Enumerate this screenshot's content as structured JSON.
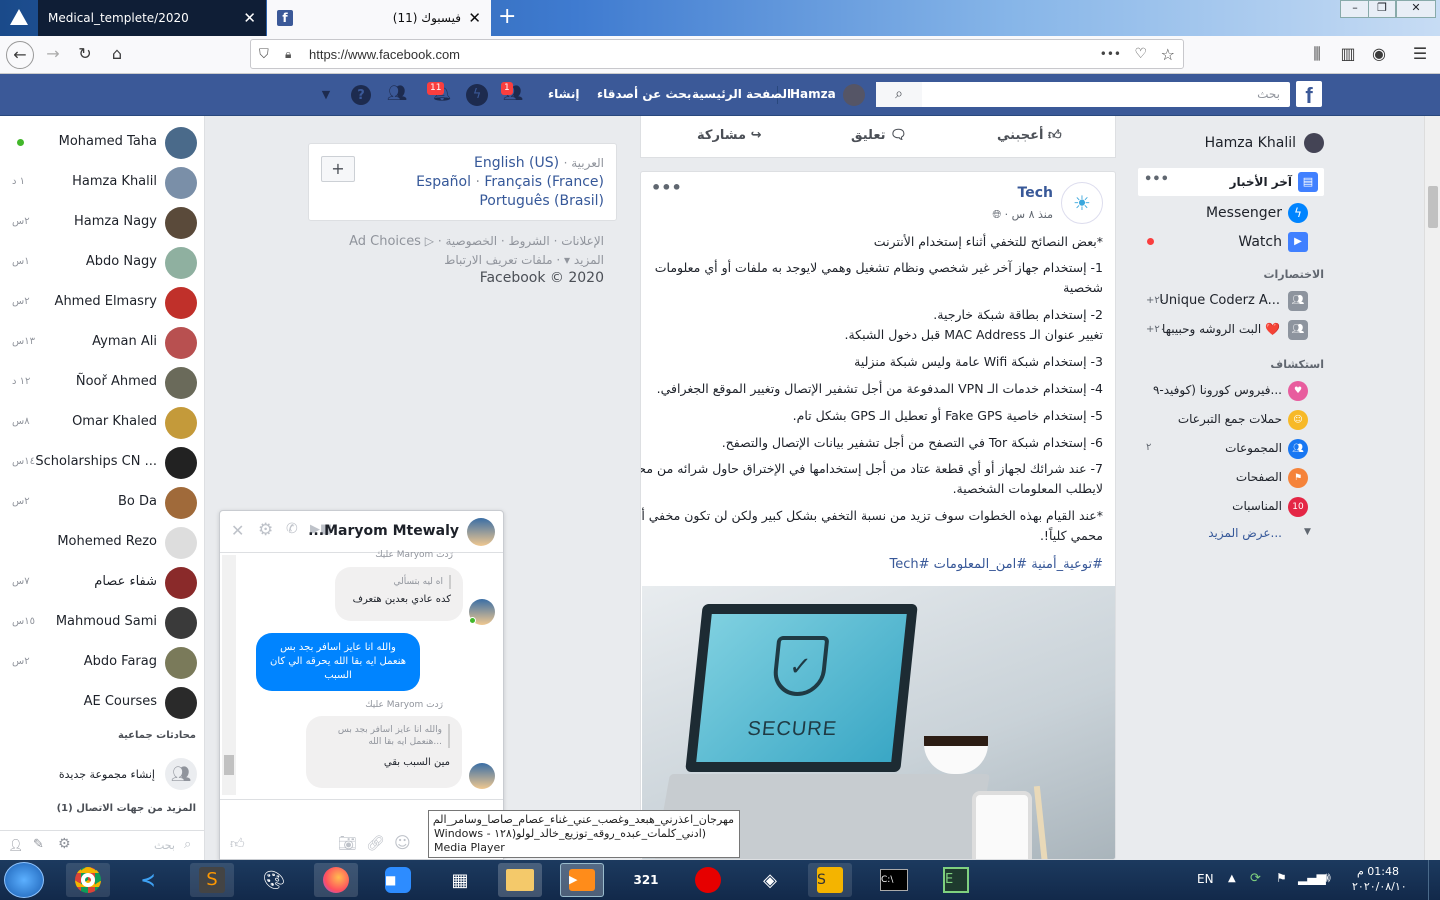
{
  "browser": {
    "tabs": [
      {
        "label": "Medical_templete/2020",
        "active": false
      },
      {
        "label": "(11) فيسبوك",
        "active": true
      }
    ],
    "new_tab": "+",
    "url": "https://www.facebook.com",
    "more": "•••"
  },
  "fb_header": {
    "search_placeholder": "بحث",
    "profile_name": "Hamza",
    "home": "الصفحة الرئيسية",
    "find_friends": "بحث عن أصدقاء",
    "create": "إنشاء",
    "friend_badge": "1",
    "notif_badge": "11"
  },
  "contacts": [
    {
      "name": "Mohamed Taha",
      "time": "",
      "online": true,
      "color": "#4a6a8a"
    },
    {
      "name": "Hamza Khalil",
      "time": "١ د",
      "online": false,
      "color": "#7a8fa8"
    },
    {
      "name": "Hamza Nagy",
      "time": "٢س",
      "online": false,
      "color": "#5a4a3a"
    },
    {
      "name": "Abdo Nagy",
      "time": "١س",
      "online": false,
      "color": "#8fb0a0"
    },
    {
      "name": "Ahmed Elmasry",
      "time": "٢س",
      "online": false,
      "color": "#c0302a"
    },
    {
      "name": "Ayman Ali",
      "time": "١٣س",
      "online": false,
      "color": "#b85050"
    },
    {
      "name": "Ñooř Ahmed",
      "time": "١٢ د",
      "online": false,
      "color": "#6a6a5a"
    },
    {
      "name": "Omar Khaled",
      "time": "٨س",
      "online": false,
      "color": "#c49a3a"
    },
    {
      "name": "Scholarships CN ...",
      "time": "١٤س",
      "online": false,
      "color": "#222222"
    },
    {
      "name": "Bo Da",
      "time": "٢س",
      "online": false,
      "color": "#a06a3a"
    },
    {
      "name": "Mohemed Rezo",
      "time": "",
      "online": false,
      "color": "#dddddd"
    },
    {
      "name": "شفاء عصام",
      "time": "٧س",
      "online": false,
      "color": "#8a2a2a"
    },
    {
      "name": "Mahmoud Sami",
      "time": "١٥س",
      "online": false,
      "color": "#3a3a3a"
    },
    {
      "name": "Abdo Farag",
      "time": "٢س",
      "online": false,
      "color": "#7a7a5a"
    },
    {
      "name": "AE Courses",
      "time": "",
      "online": false,
      "color": "#2a2a2a"
    }
  ],
  "chat_sidebar": {
    "group_header": "محادثات جماعية",
    "new_group": "إنشاء مجموعة جديدة",
    "more_contacts": "المزيد من جهات الاتصال (1)",
    "search_placeholder": "بحث"
  },
  "chat_window": {
    "title": "Maryom Mtewaly...",
    "reply_top": "رَدت Maryom عليك",
    "quoted_top": "اه ليه بتسألي",
    "msg_in_1": "كده عادي بعدين هتعرف",
    "msg_out": "والله انا عايز اسافر بجد بس هنعمل ايه بقا الله يحرقه الي كان السبب",
    "reply_bottom": "رَدت Maryom عليك",
    "quoted_bottom": "والله انا عايز اسافر بجد بس هنعمل ايه بقا الله...",
    "msg_in_2": "مين السبب بقي"
  },
  "language_box": {
    "current": "العربية",
    "languages": [
      "English (US)",
      "Español",
      "Français (France)",
      "Português (Brasil)"
    ],
    "add": "+"
  },
  "footer_links": {
    "line1": [
      "الخصوصية",
      "الشروط",
      "الإعلانات",
      "Ad Choices"
    ],
    "line2": [
      "ملفات تعريف الارتباط",
      "المزيد"
    ],
    "copyright": "Facebook © 2020"
  },
  "post_actions": {
    "like": "أعجبني",
    "comment": "تعليق",
    "share": "مشاركة"
  },
  "post": {
    "page_name": "Tech",
    "time": "منذ ٨ س",
    "lines": [
      "*بعض النصائح للتخفي أثناء إستخدام الأنترنت",
      "1- إستخدام جهاز آخر غير شخصي ونظام تشغيل وهمي لايوجد به ملفات أو أي معلومات",
      "شخصية",
      "2- إستخدام بطاقة شبكة خارجية.",
      "تغيير عنوان الـ MAC Address قبل دخول الشبكة.",
      "3- إستخدام شبكة Wifi عامة وليس شبكة منزلية",
      "4- إستخدام خدمات الـ VPN المدفوعة من أجل تشفير الإتصال وتغيير الموقع الجغرافي.",
      "5- إستخدام خاصية Fake GPS أو تعطيل الـ GPS بشكل تام.",
      "6- إستخدام شبكة Tor في التصفح من أجل تشفير بيانات الإتصال والتصفح.",
      "7- عند شرائك لجهاز أو أي قطعة عتاد من أجل إستخدامها في الإختراق حاول شرائه من محل",
      "لايطلب المعلومات الشخصية.",
      "*عند القيام بهذه الخطوات سوف تزيد من نسبة التخفي بشكل كبير ولكن لن تكون مخفي أو",
      "محمي كلياً!."
    ],
    "hashtags": "#توعية_أمنية #امن_المعلومات #Tech",
    "image_text": "SECURE"
  },
  "right_nav": {
    "user": "Hamza Khalil",
    "news_feed": "آخر الأخبار",
    "messenger": "Messenger",
    "watch": "Watch",
    "shortcuts_header": "الاختصارات",
    "shortcut_1": "Unique Coderz A...",
    "shortcut_1_count": "+٢٠",
    "shortcut_2": "البت الروشه وحبيبها ❤️",
    "shortcut_2_count": "+٢٠",
    "explore_header": "استكشاف",
    "explore": [
      {
        "label": "فيروس كورونا (كوفيد-٩...",
        "count": ""
      },
      {
        "label": "حملات جمع التبرعات",
        "count": ""
      },
      {
        "label": "المجموعات",
        "count": "٢"
      },
      {
        "label": "الصفحات",
        "count": ""
      },
      {
        "label": "المناسبات",
        "count": ""
      }
    ],
    "see_more": "عرض المزيد..."
  },
  "taskbar": {
    "tooltip": "مهرجان_اعذرني_هبعد_وغصب_عني_غناء_عصام_صاصا_وسامر_الم (ادني_كلمات_عبده_روقه_توزيع_خالد_لولو(١٢٨ - Windows Media Player",
    "lang": "EN",
    "time": "01:48 م",
    "date": "٢٠٢٠/٠٨/١٠"
  }
}
